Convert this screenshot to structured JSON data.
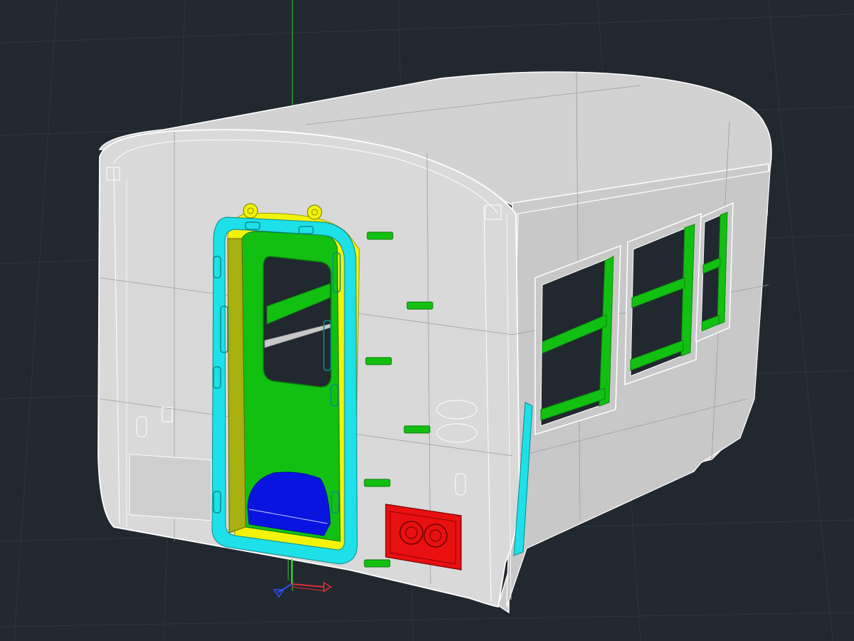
{
  "viewport": {
    "background": "#212830",
    "grid_color": "#2d3540",
    "model_color": "#d7d7d7",
    "edge_color": "#ffffff"
  },
  "colors": {
    "door_frame": "#1ee0e8",
    "door_surround": "#f2f20a",
    "door_panel": "#12c012",
    "window_frames": "#12c012",
    "brackets": "#12c012",
    "coupler_box": "#e81010",
    "seat": "#0a14e0",
    "side_strip": "#1ee0e8"
  },
  "ucs": {
    "x_axis_color": "#e03030",
    "y_axis_color": "#30d030",
    "z_axis_color": "#3050ff"
  },
  "icons": [
    "ucs-icon"
  ]
}
